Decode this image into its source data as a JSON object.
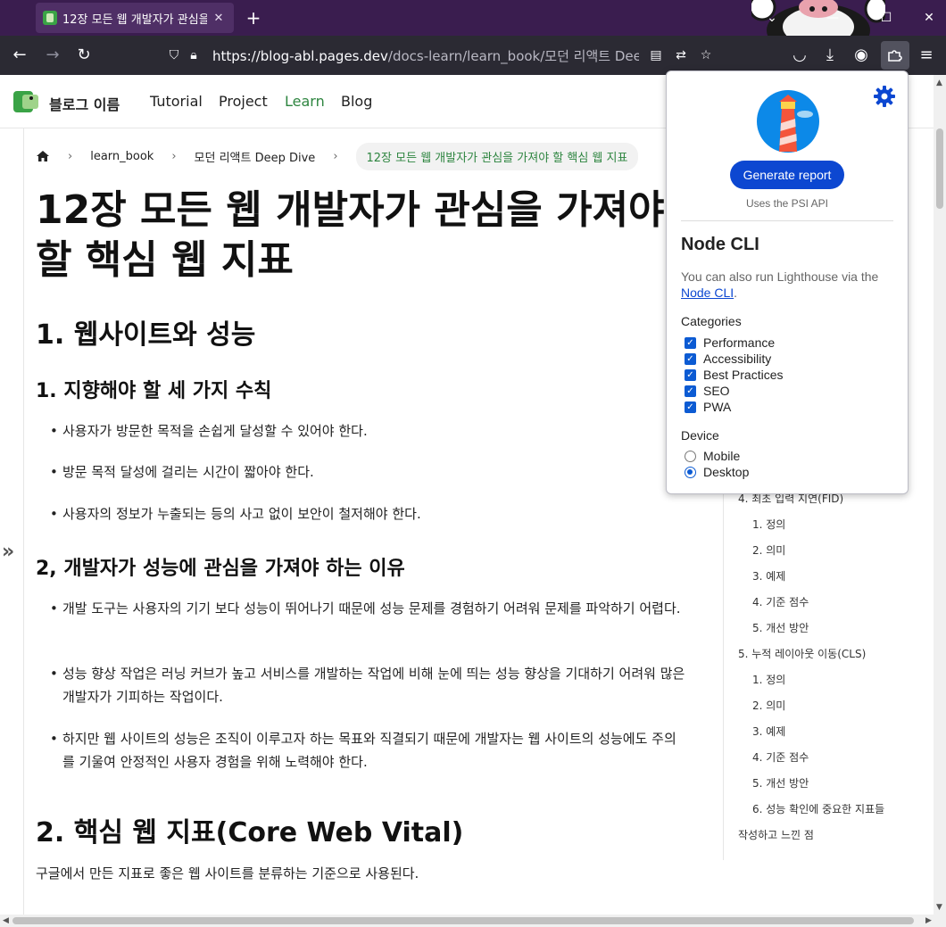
{
  "browser": {
    "tab_title": "12장 모든 웹 개발자가 관심을",
    "url_host": "https://blog-abl.pages.dev",
    "url_path": "/docs-learn/learn_book/모던 리액트 Deep Dive/ch"
  },
  "site": {
    "title": "블로그 이름",
    "nav": [
      "Tutorial",
      "Project",
      "Learn",
      "Blog"
    ]
  },
  "breadcrumb": [
    "learn_book",
    "모던 리액트 Deep Dive",
    "12장 모든 웹 개발자가 관심을 가져야 할 핵심 웹 지표"
  ],
  "article": {
    "title": "12장 모든 웹 개발자가 관심을 가져야 할 핵심 웹 지표",
    "section1": "1. 웹사이트와 성능",
    "sub1": "1. 지향해야 할 세 가지 수칙",
    "sub1_items": [
      "사용자가 방문한 목적을 손쉽게 달성할 수 있어야 한다.",
      "방문 목적 달성에 걸리는 시간이 짧아야 한다.",
      "사용자의 정보가 누출되는 등의 사고 없이 보안이 철저해야 한다."
    ],
    "sub2": "2, 개발자가 성능에 관심을 가져야 하는 이유",
    "sub2_items": [
      "개발 도구는 사용자의 기기 보다 성능이 뛰어나기 때문에 성능 문제를 경험하기 어려워 문제를 파악하기 어렵다.",
      "성능 향상 작업은 러닝 커브가 높고 서비스를 개발하는 작업에 비해 눈에 띄는 성능 향상을 기대하기 어려워 많은 개발자가 기피하는 작업이다.",
      "하지만 웹 사이트의 성능은 조직이 이루고자 하는 목표와 직결되기 때문에 개발자는 웹 사이트의 성능에도 주의를 기울여 안정적인 사용자 경험을 위해 노력해야 한다."
    ],
    "section2": "2. 핵심 웹 지표(Core Web Vital)",
    "section2_text": "구글에서 만든 지표로 좋은 웹 사이트를 분류하는 기준으로 사용된다."
  },
  "toc": [
    "4. 최초 입력 지연(FID)",
    "1. 정의",
    "2. 의미",
    "3. 예제",
    "4. 기준 점수",
    "5. 개선 방안",
    "5. 누적 레이아웃 이동(CLS)",
    "1. 정의",
    "2. 의미",
    "3. 예제",
    "4. 기준 점수",
    "5. 개선 방안",
    "6. 성능 확인에 중요한 지표들",
    "작성하고 느낀 점"
  ],
  "lighthouse": {
    "generate_label": "Generate report",
    "psi_note": "Uses the PSI API",
    "heading": "Node CLI",
    "desc_prefix": "You can also run Lighthouse via the ",
    "desc_link": "Node CLI",
    "desc_suffix": ".",
    "categories_label": "Categories",
    "categories": [
      "Performance",
      "Accessibility",
      "Best Practices",
      "SEO",
      "PWA"
    ],
    "device_label": "Device",
    "devices": [
      "Mobile",
      "Desktop"
    ],
    "selected_device": "Desktop"
  }
}
